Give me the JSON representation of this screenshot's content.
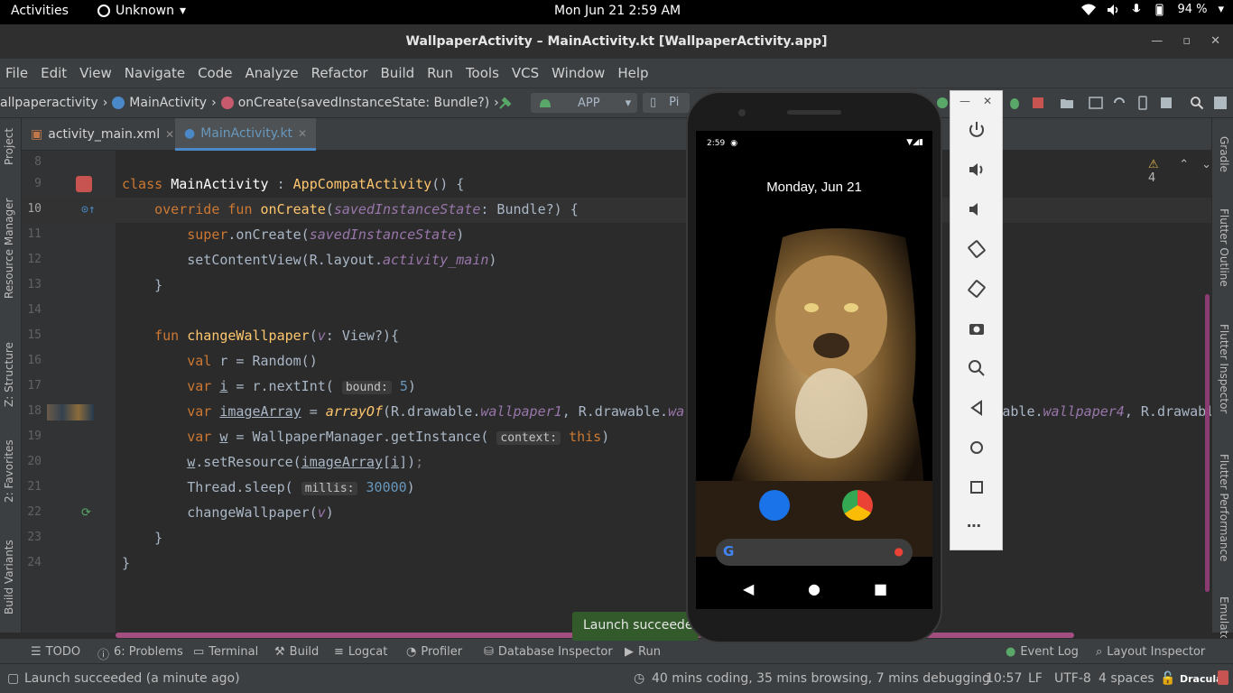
{
  "gnome": {
    "activities": "Activities",
    "app_name": "Unknown",
    "clock": "Mon Jun 21   2:59 AM",
    "battery": "94 %"
  },
  "window": {
    "title": "WallpaperActivity – MainActivity.kt [WallpaperActivity.app]"
  },
  "menu": [
    "File",
    "Edit",
    "View",
    "Navigate",
    "Code",
    "Analyze",
    "Refactor",
    "Build",
    "Run",
    "Tools",
    "VCS",
    "Window",
    "Help"
  ],
  "breadcrumb": {
    "package": "allpaperactivity",
    "class": "MainActivity",
    "method": "onCreate(savedInstanceState: Bundle?)",
    "run_config": "APP",
    "device_partial": "Pi"
  },
  "tabs": [
    {
      "label": "activity_main.xml"
    },
    {
      "label": "MainActivity.kt"
    }
  ],
  "left_tools": [
    "Project",
    "Resource Manager",
    "Z: Structure",
    "2: Favorites",
    "Build Variants"
  ],
  "right_tools": [
    "Gradle",
    "Flutter Outline",
    "Flutter Inspector",
    "Flutter Performance",
    "Emulator"
  ],
  "editor": {
    "warnings": "4",
    "line_numbers": [
      "8",
      "9",
      "10",
      "11",
      "12",
      "13",
      "14",
      "15",
      "16",
      "17",
      "18",
      "19",
      "20",
      "21",
      "22",
      "23",
      "24"
    ],
    "hints": {
      "bound": "bound:",
      "context": "context:",
      "millis": "millis:"
    }
  },
  "bottom_tools": [
    "TODO",
    "6: Problems",
    "Terminal",
    "Build",
    "Logcat",
    "Profiler",
    "Database Inspector",
    "Run",
    "Event Log",
    "Layout Inspector"
  ],
  "status": {
    "message": "Launch succeeded (a minute ago)",
    "time_tracker": "40 mins coding, 35 mins browsing, 7 mins debugging",
    "position": "10:57",
    "line_sep": "LF",
    "encoding": "UTF-8",
    "indent": "4 spaces",
    "theme": "Dracula"
  },
  "popup": "Launch succeeded",
  "phone": {
    "status_time": "2:59",
    "date": "Monday, Jun 21"
  },
  "colors": {
    "keyword": "#cc7832",
    "function": "#ffc66d",
    "param": "#9876aa",
    "number": "#6897bb",
    "editor_bg": "#2b2b2b",
    "panel_bg": "#3c3f41",
    "accent": "#4a88c7"
  }
}
